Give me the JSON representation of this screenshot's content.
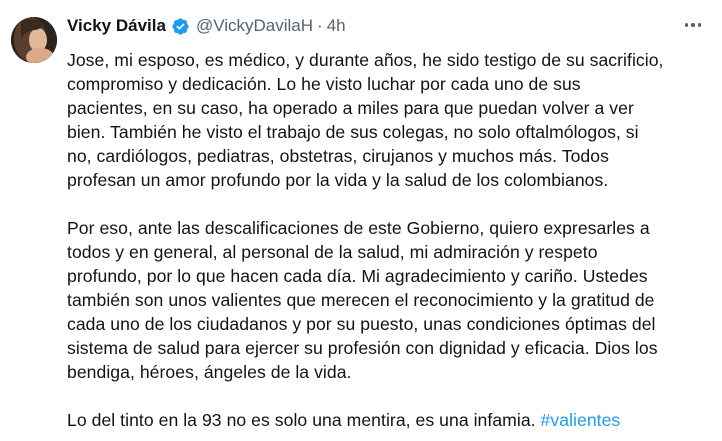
{
  "tweet": {
    "author": {
      "display_name": "Vicky Dávila",
      "handle": "@VickyDavilaH",
      "verified_icon": "verified-badge-icon",
      "avatar_icon": "avatar-photo"
    },
    "separator": "·",
    "time": "4h",
    "more_icon": "more-options-icon",
    "paragraphs": [
      [
        "Jose, mi esposo, es médico, y durante años, he sido testigo de su sacrificio,",
        "compromiso y dedicación. Lo he visto luchar por cada uno de sus",
        "pacientes, en su caso, ha operado a miles para que puedan volver a ver",
        "bien. También he visto el trabajo de sus colegas, no solo oftalmólogos, si",
        "no, cardiólogos, pediatras, obstetras, cirujanos y muchos más.  Todos",
        "profesan un amor profundo por la vida y la salud de los colombianos."
      ],
      [
        "Por eso, ante las descalificaciones de este Gobierno, quiero  expresarles a",
        "todos y en general, al personal de la salud, mi admiración y respeto",
        "profundo, por lo que hacen cada día. Mi agradecimiento y cariño. Ustedes",
        "también son unos valientes que merecen el reconocimiento y la gratitud de",
        "cada uno de los ciudadanos y por su puesto, unas condiciones óptimas del",
        "sistema de salud para ejercer su profesión con dignidad y eficacia. Dios los",
        "bendiga, héroes, ángeles de la vida."
      ]
    ],
    "last_line": {
      "text": "Lo del tinto en la 93 no es solo una mentira, es una infamia. ",
      "hashtag": "#valientes"
    },
    "colors": {
      "text": "#0f1419",
      "secondary": "#536471",
      "link": "#1d9bf0",
      "verified": "#1d9bf0"
    }
  }
}
